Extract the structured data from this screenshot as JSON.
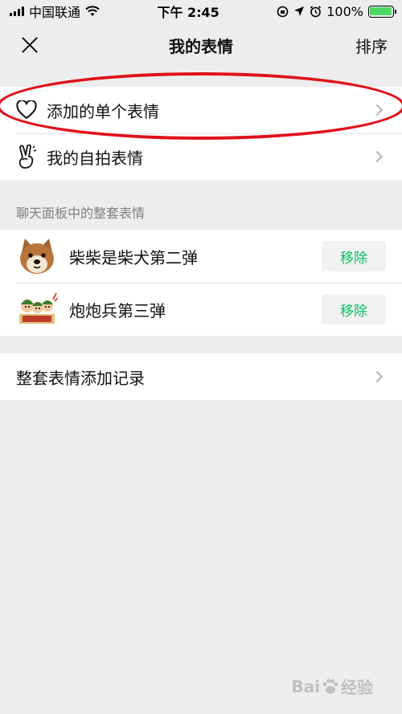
{
  "status_bar": {
    "carrier": "中国联通",
    "time": "下午 2:45",
    "battery": "100%"
  },
  "nav": {
    "title": "我的表情",
    "sort_label": "排序"
  },
  "personal": {
    "items": [
      {
        "label": "添加的单个表情",
        "icon": "heart-icon"
      },
      {
        "label": "我的自拍表情",
        "icon": "victory-hand-icon"
      }
    ]
  },
  "packs_section": {
    "header": "聊天面板中的整套表情",
    "packs": [
      {
        "name": "柴柴是柴犬第二弹",
        "remove_label": "移除",
        "thumb": "shiba-dog-thumbnail"
      },
      {
        "name": "炮炮兵第三弹",
        "remove_label": "移除",
        "thumb": "soldiers-thumbnail"
      }
    ]
  },
  "history": {
    "label": "整套表情添加记录"
  },
  "watermark": {
    "text": "Bai",
    "suffix": "经验"
  },
  "colors": {
    "accent_green": "#07c160",
    "highlight_red": "#e0101a",
    "background": "#ededed"
  }
}
